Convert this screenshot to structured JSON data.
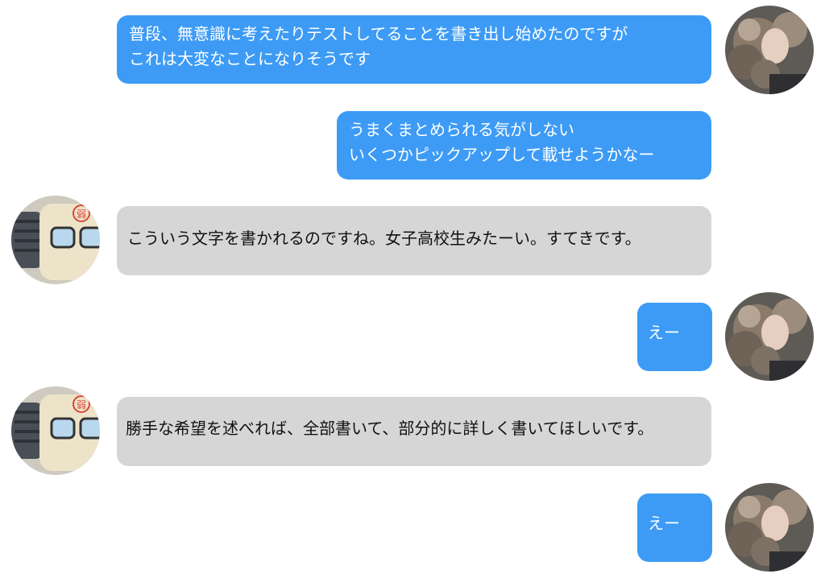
{
  "messages": [
    {
      "id": "m1",
      "sender": "self",
      "lines": [
        "普段、無意識に考えたりテストしてることを書き出し始めたのですが",
        "これは大変なことになりそうです"
      ]
    },
    {
      "id": "m2",
      "sender": "self",
      "lines": [
        "うまくまとめられる気がしない",
        "いくつかピックアップして載せようかなー"
      ]
    },
    {
      "id": "m3",
      "sender": "other",
      "lines": [
        "こういう文字を書かれるのですね。女子高校生みたーい。すてきです。"
      ]
    },
    {
      "id": "m4",
      "sender": "self",
      "lines": [
        "えー"
      ]
    },
    {
      "id": "m5",
      "sender": "other",
      "lines": [
        "勝手な希望を述べれば、全部書いて、部分的に詳しく書いてほしいです。"
      ]
    },
    {
      "id": "m6",
      "sender": "self",
      "lines": [
        "えー"
      ]
    }
  ],
  "avatars": {
    "self": {
      "icon": "curly-hair-person-photo"
    },
    "other": {
      "icon": "glasses-mascot-photo",
      "stamp_text": "弱"
    }
  },
  "colors": {
    "outgoing_bubble": "#3d9bf5",
    "incoming_bubble": "#d6d6d6",
    "outgoing_text": "#ffffff",
    "incoming_text": "#111111"
  }
}
